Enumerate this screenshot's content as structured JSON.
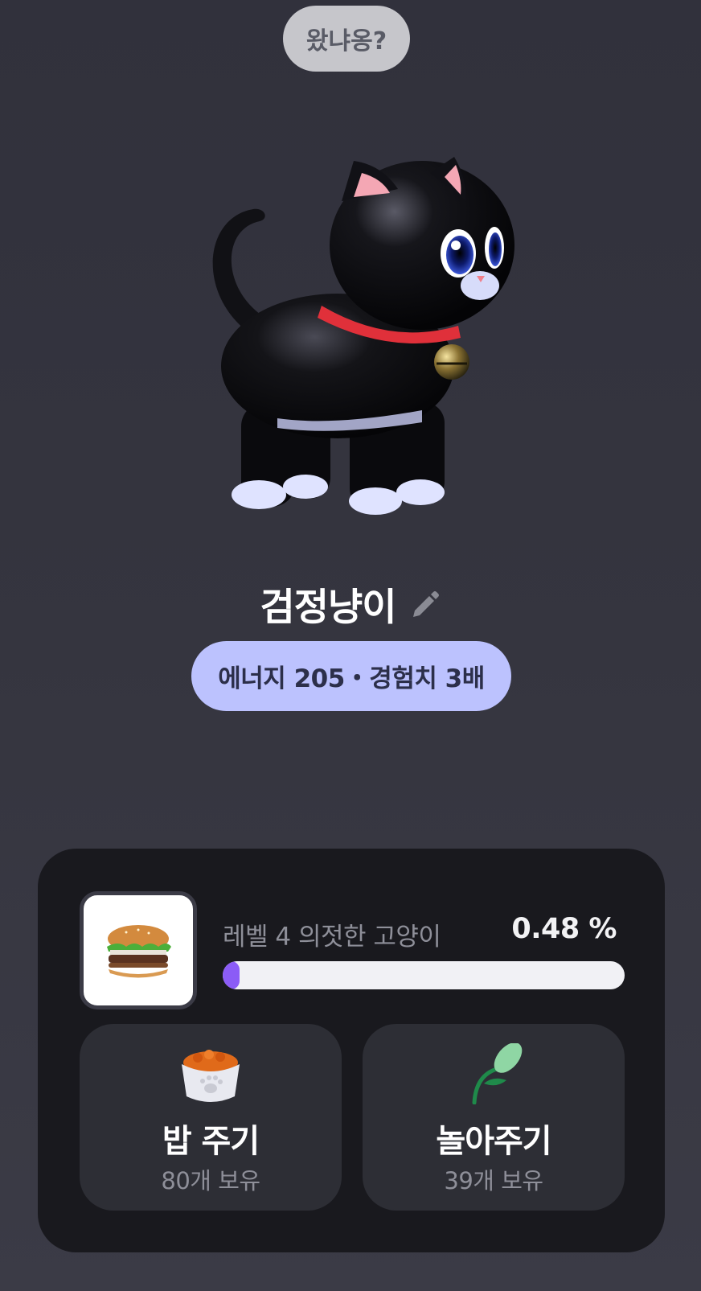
{
  "greeting": {
    "bubble_text": "왔냐옹?"
  },
  "pet": {
    "name": "검정냥이",
    "image": "black-cat-3d",
    "edit_icon": "pencil-icon",
    "stats_text": "에너지 205・경험치 3배"
  },
  "level": {
    "label": "레벨 4 의젓한 고양이",
    "percent_text": "0.48 %",
    "progress_fraction": 0.0048,
    "item_icon": "hamburger-icon"
  },
  "actions": {
    "feed": {
      "icon": "food-bowl-icon",
      "label": "밥 주기",
      "count_text": "80개 보유"
    },
    "play": {
      "icon": "cat-toy-icon",
      "label": "놀아주기",
      "count_text": "39개 보유"
    }
  },
  "colors": {
    "background": "#35353f",
    "panel": "#19191e",
    "card": "#2d2e35",
    "pill": "#bcc2fe",
    "progress": "#8b5cf6",
    "bubble": "#c6c6cb"
  }
}
